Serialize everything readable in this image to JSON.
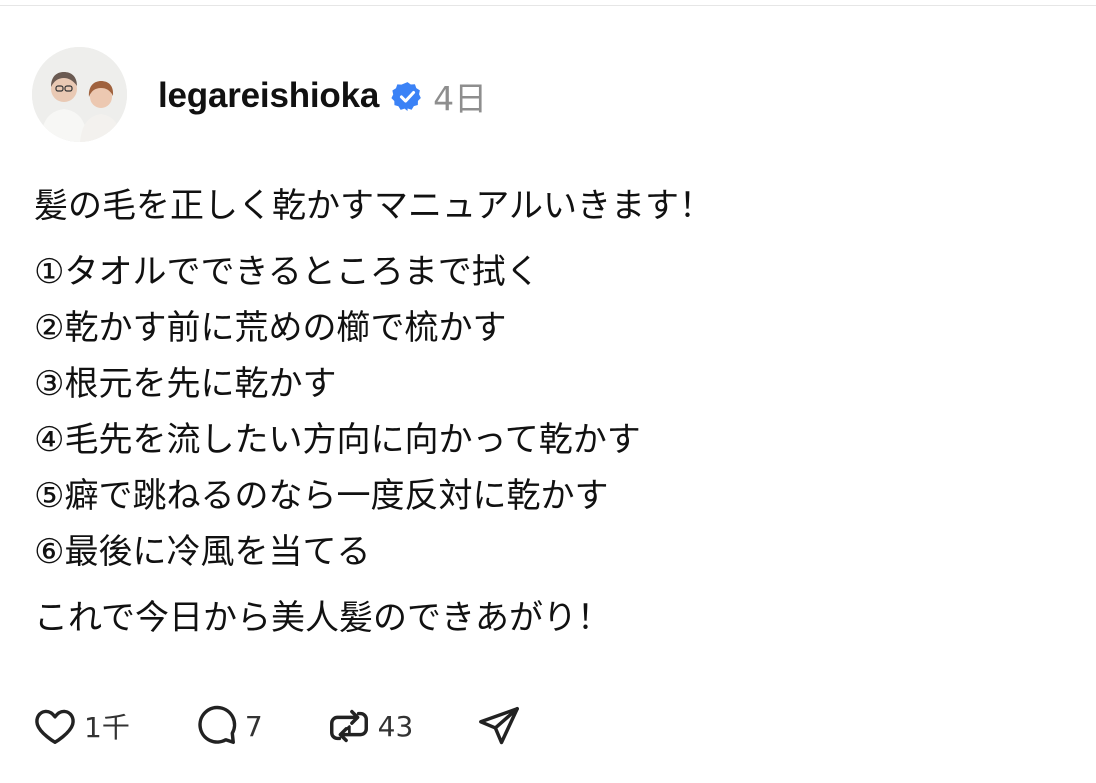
{
  "post": {
    "username": "legareishioka",
    "timestamp": "4日",
    "intro": "髪の毛を正しく乾かすマニュアルいきます！",
    "steps": [
      "①タオルでできるところまで拭く",
      "②乾かす前に荒めの櫛で梳かす",
      "③根元を先に乾かす",
      "④毛先を流したい方向に向かって乾かす",
      "⑤癖で跳ねるのなら一度反対に乾かす",
      "⑥最後に冷風を当てる"
    ],
    "outro": "これで今日から美人髪のできあがり！"
  },
  "actions": {
    "like_count": "1千",
    "reply_count": "7",
    "repost_count": "43"
  },
  "icons": {
    "like": "heart-icon",
    "reply": "comment-bubble-icon",
    "repost": "repost-icon",
    "share": "send-icon",
    "verified": "verified-badge-icon"
  },
  "colors": {
    "verified_badge": "#3b82f6",
    "timestamp": "#8e8e8e",
    "text": "#111111"
  }
}
